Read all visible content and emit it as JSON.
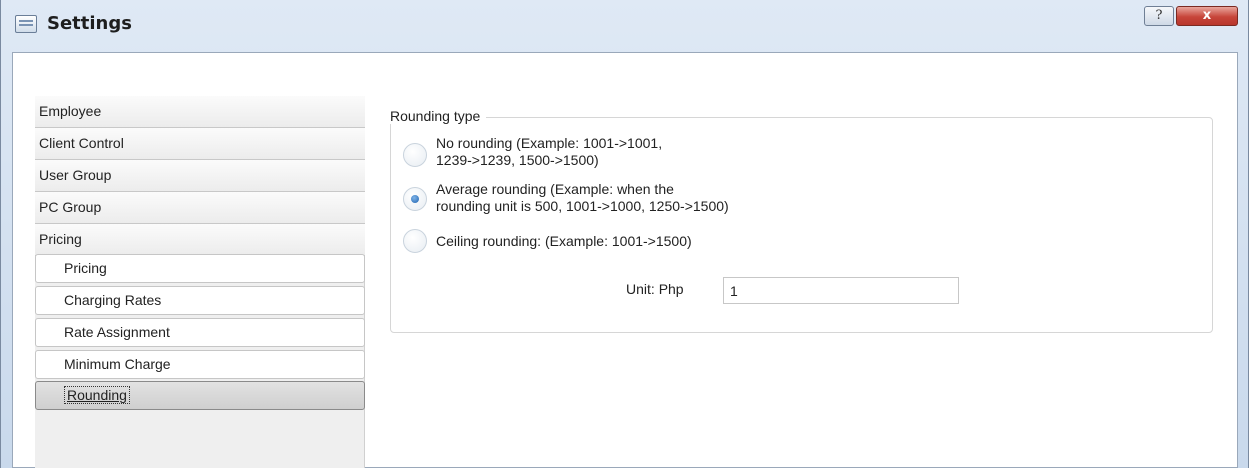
{
  "window": {
    "title": "Settings",
    "help_label": "?",
    "close_label": "x"
  },
  "sidebar": {
    "items": [
      {
        "label": "Employee"
      },
      {
        "label": "Client Control"
      },
      {
        "label": "User Group"
      },
      {
        "label": "PC Group"
      },
      {
        "label": "Pricing"
      }
    ],
    "sub_items": [
      {
        "label": "Pricing",
        "selected": false
      },
      {
        "label": "Charging Rates",
        "selected": false
      },
      {
        "label": "Rate Assignment",
        "selected": false
      },
      {
        "label": "Minimum Charge",
        "selected": false
      },
      {
        "label": "Rounding",
        "selected": true
      }
    ]
  },
  "rounding": {
    "group_label": "Rounding type",
    "options": [
      {
        "line1": "No rounding (Example: 1001->1001,",
        "line2": "1239->1239, 1500->1500)",
        "checked": false
      },
      {
        "line1": "Average rounding (Example: when the",
        "line2": "rounding unit is 500, 1001->1000, 1250->1500)",
        "checked": true
      },
      {
        "line1": "Ceiling rounding: (Example: 1001->1500)",
        "line2": "",
        "checked": false
      }
    ],
    "unit_label": "Unit:",
    "currency": "Php",
    "unit_value": "1"
  }
}
